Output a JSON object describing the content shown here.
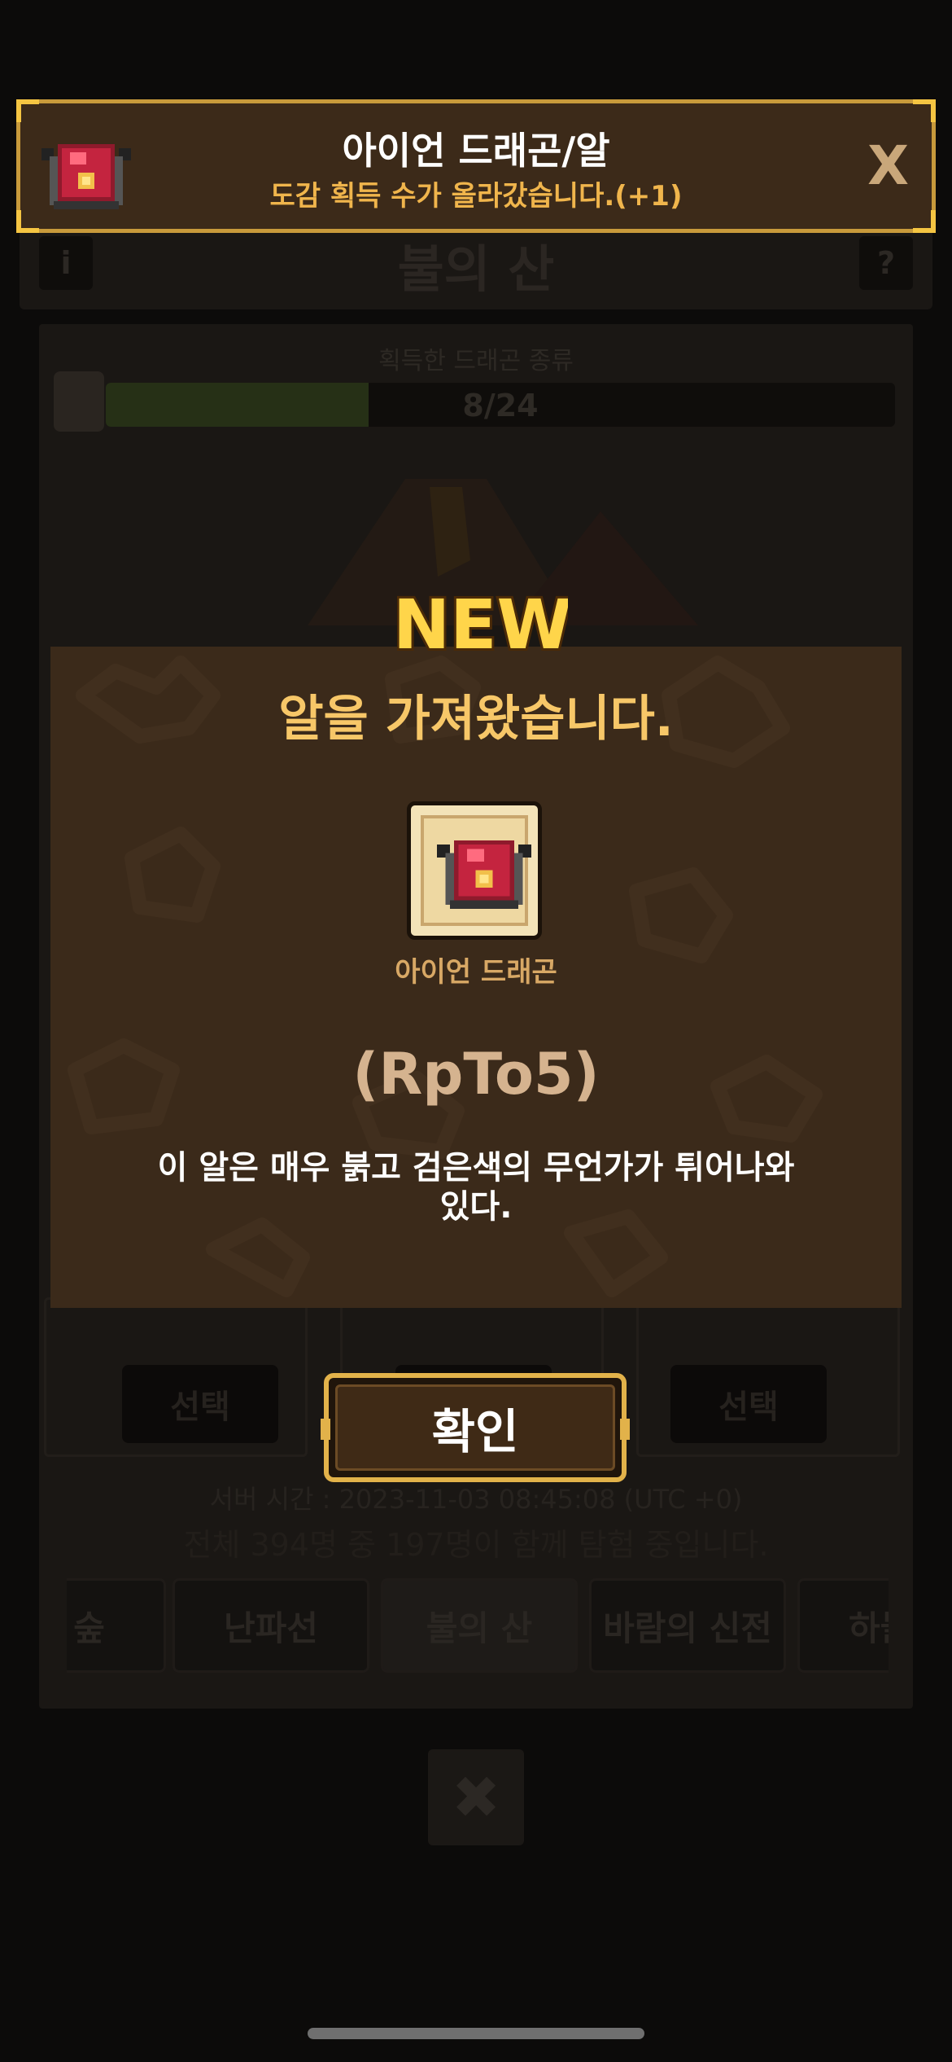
{
  "background": {
    "title": "불의 산",
    "info_button": "i",
    "help_button": "?",
    "progress_label": "획득한 드래곤 종류",
    "progress_text": "8/24",
    "progress_fraction": 0.333,
    "select_labels": [
      "선택",
      "선택",
      "선택"
    ],
    "server_time": "서버 시간 : 2023-11-03 08:45:08 (UTC +0)",
    "users_text": "전체 394명 중 197명이 함께 탐험 중입니다.",
    "tabs": [
      "의 숲",
      "난파선",
      "불의 산",
      "바람의 신전",
      "하늘의"
    ],
    "active_tab": "불의 산",
    "close_button": "✖"
  },
  "banner": {
    "title": "아이언 드래곤/알",
    "subtitle": "도감 획득 수가 올라갔습니다.(+1)",
    "close_label": "X",
    "icon": "red-dragon-egg-icon"
  },
  "modal": {
    "badge": "NEW",
    "title": "알을 가져왔습니다.",
    "item_name": "아이언 드래곤",
    "item_code": "(RpTo5)",
    "description": "이 알은 매우 붉고 검은색의 무언가가 튀어나와 있다.",
    "item_icon": "red-dragon-egg-icon"
  },
  "confirm_button": {
    "label": "확인"
  },
  "colors": {
    "banner_bg": "#3c2a19",
    "banner_border": "#c89a3b",
    "accent_gold": "#f0b54c",
    "modal_bg": "#3b2a1a",
    "egg_red": "#c4243f"
  }
}
